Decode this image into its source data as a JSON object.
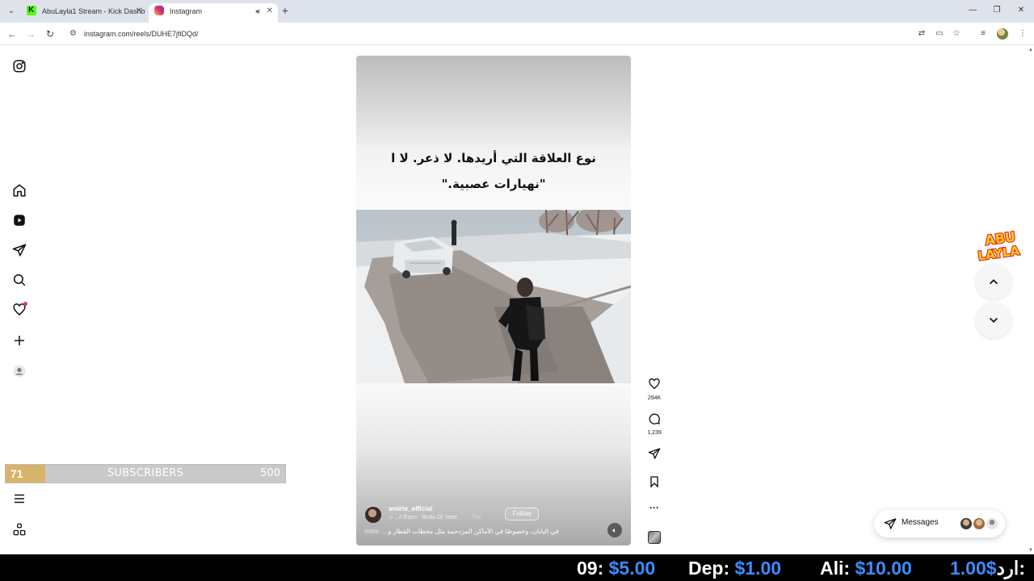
{
  "browser": {
    "tabs": [
      {
        "title": "AbuLayla1 Stream - Kick Dashb",
        "active": false
      },
      {
        "title": "Instagram",
        "active": true
      }
    ],
    "url": "instagram.com/reels/DUHE7jfiDQd/"
  },
  "sidebar": {
    "items": [
      "instagram-logo",
      "home",
      "reels",
      "messages",
      "search",
      "notifications",
      "create",
      "profile",
      "more",
      "also-from-meta"
    ]
  },
  "subscribers": {
    "current": "71",
    "label": "SUBSCRIBERS",
    "goal": "500",
    "progress_fraction": 0.142
  },
  "reel": {
    "caption_line1": "نوع العلاقة التي أريدها. لا ذعر. لا ا",
    "caption_line2": "\"نهيارات عصبية.\"",
    "username": "amirte_official",
    "audio_track": "...n Esen · Mutlu Ol Yeter",
    "audio_track2": "Tim",
    "follow_label": "Follow",
    "description": "في اليابان، وخصوصًا في الأماكن المزدحمة مثل محطات القطار و ...",
    "more_label": "more"
  },
  "actions": {
    "likes": "294K",
    "comments": "1,239"
  },
  "messages_label": "Messages",
  "logo_text": {
    "line1": "ABU",
    "line2": "LAYLA"
  },
  "ticker": [
    {
      "name": "09:",
      "amount": "$5.00"
    },
    {
      "name": "Dep:",
      "amount": "$1.00"
    },
    {
      "name": "Ali:",
      "amount": "$10.00"
    },
    {
      "name": "ارد:",
      "amount": "1.00$"
    }
  ],
  "colors": {
    "ticker_amount": "#3d8bff",
    "notification_dot": "#ff3040",
    "subscriber_fill": "#d8b36a",
    "logo_yellow": "#ffcc1a",
    "logo_red": "#e0201b"
  }
}
